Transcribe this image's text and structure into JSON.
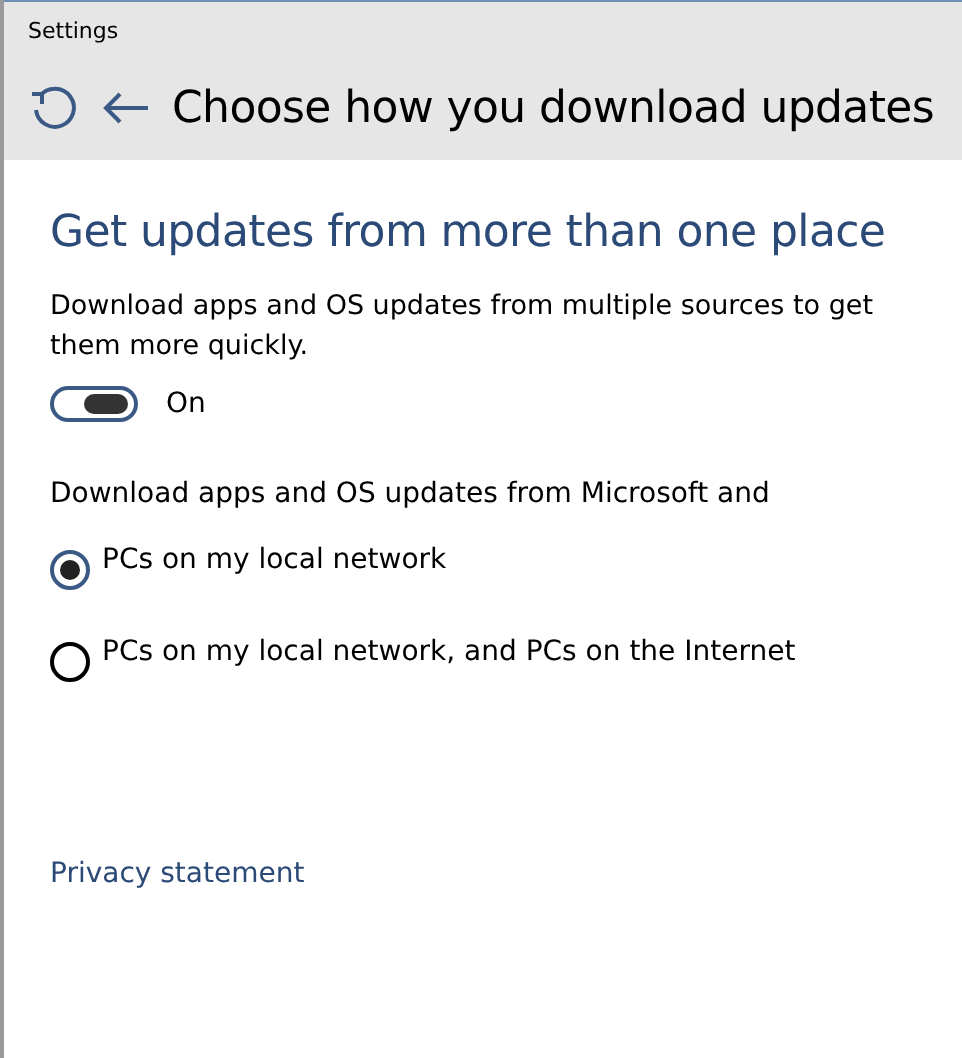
{
  "window": {
    "title": "Settings"
  },
  "header": {
    "title": "Choose how you download updates"
  },
  "section": {
    "heading": "Get updates from more than one place",
    "description": "Download apps and OS updates from multiple sources to get them more quickly.",
    "toggle": {
      "on": true,
      "label": "On"
    }
  },
  "source": {
    "label": "Download apps and OS updates from Microsoft and",
    "options": [
      {
        "label": "PCs on my local network",
        "selected": true
      },
      {
        "label": "PCs on my local network, and PCs on the Internet",
        "selected": false
      }
    ]
  },
  "link": "Privacy statement"
}
